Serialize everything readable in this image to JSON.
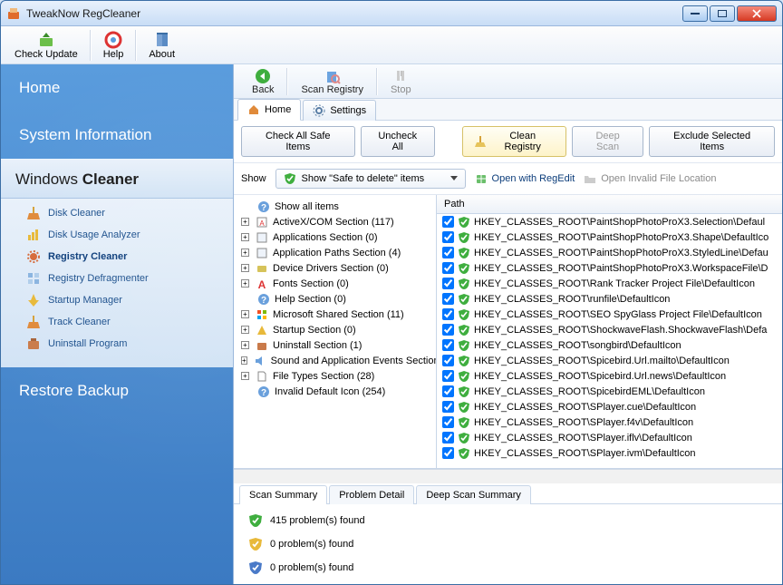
{
  "window": {
    "title": "TweakNow RegCleaner"
  },
  "toolbar_top": {
    "check_update": "Check Update",
    "help": "Help",
    "about": "About"
  },
  "sidebar": {
    "home": "Home",
    "system_info": "System Information",
    "cleaner_prefix": "Windows ",
    "cleaner_bold": "Cleaner",
    "restore": "Restore Backup",
    "sub": [
      {
        "label": "Disk Cleaner",
        "icon": "broom"
      },
      {
        "label": "Disk Usage Analyzer",
        "icon": "chart"
      },
      {
        "label": "Registry Cleaner",
        "icon": "gear",
        "active": true
      },
      {
        "label": "Registry Defragmenter",
        "icon": "defrag"
      },
      {
        "label": "Startup Manager",
        "icon": "startup"
      },
      {
        "label": "Track Cleaner",
        "icon": "broom"
      },
      {
        "label": "Uninstall Program",
        "icon": "uninstall"
      }
    ]
  },
  "main_toolbar": {
    "back": "Back",
    "scan": "Scan Registry",
    "stop": "Stop"
  },
  "tabs": {
    "home": "Home",
    "settings": "Settings"
  },
  "actions": {
    "check_all": "Check All Safe Items",
    "uncheck_all": "Uncheck All",
    "clean": "Clean Registry",
    "deep_scan": "Deep Scan",
    "exclude": "Exclude Selected Items"
  },
  "filter": {
    "show_label": "Show",
    "dropdown_text": "Show \"Safe to delete\" items",
    "open_regedit": "Open with RegEdit",
    "open_invalid": "Open Invalid File Location"
  },
  "tree": [
    {
      "label": "Show all items",
      "icon": "q"
    },
    {
      "label": "ActiveX/COM Section (117)",
      "icon": "ax",
      "exp": true
    },
    {
      "label": "Applications Section (0)",
      "icon": "app",
      "exp": true
    },
    {
      "label": "Application Paths Section (4)",
      "icon": "app",
      "exp": true
    },
    {
      "label": "Device Drivers Section (0)",
      "icon": "dev",
      "exp": true
    },
    {
      "label": "Fonts Section (0)",
      "icon": "font",
      "exp": true
    },
    {
      "label": "Help Section (0)",
      "icon": "q"
    },
    {
      "label": "Microsoft Shared Section (11)",
      "icon": "ms",
      "exp": true
    },
    {
      "label": "Startup Section (0)",
      "icon": "start",
      "exp": true
    },
    {
      "label": "Uninstall Section (1)",
      "icon": "uninst",
      "exp": true
    },
    {
      "label": "Sound and Application Events Section",
      "icon": "sound",
      "exp": true
    },
    {
      "label": "File Types Section (28)",
      "icon": "file",
      "exp": true
    },
    {
      "label": "Invalid Default Icon (254)",
      "icon": "q"
    }
  ],
  "list_header": "Path",
  "list": [
    "HKEY_CLASSES_ROOT\\PaintShopPhotoProX3.Selection\\Defaul",
    "HKEY_CLASSES_ROOT\\PaintShopPhotoProX3.Shape\\DefaultIco",
    "HKEY_CLASSES_ROOT\\PaintShopPhotoProX3.StyledLine\\Defau",
    "HKEY_CLASSES_ROOT\\PaintShopPhotoProX3.WorkspaceFile\\D",
    "HKEY_CLASSES_ROOT\\Rank Tracker Project File\\DefaultIcon",
    "HKEY_CLASSES_ROOT\\runfile\\DefaultIcon",
    "HKEY_CLASSES_ROOT\\SEO SpyGlass Project File\\DefaultIcon",
    "HKEY_CLASSES_ROOT\\ShockwaveFlash.ShockwaveFlash\\Defa",
    "HKEY_CLASSES_ROOT\\songbird\\DefaultIcon",
    "HKEY_CLASSES_ROOT\\Spicebird.Url.mailto\\DefaultIcon",
    "HKEY_CLASSES_ROOT\\Spicebird.Url.news\\DefaultIcon",
    "HKEY_CLASSES_ROOT\\SpicebirdEML\\DefaultIcon",
    "HKEY_CLASSES_ROOT\\SPlayer.cue\\DefaultIcon",
    "HKEY_CLASSES_ROOT\\SPlayer.f4v\\DefaultIcon",
    "HKEY_CLASSES_ROOT\\SPlayer.iflv\\DefaultIcon",
    "HKEY_CLASSES_ROOT\\SPlayer.ivm\\DefaultIcon"
  ],
  "bottom_tabs": {
    "summary": "Scan Summary",
    "detail": "Problem Detail",
    "deep": "Deep Scan Summary"
  },
  "summary": [
    {
      "shield": "green",
      "text": "415 problem(s) found"
    },
    {
      "shield": "yellow",
      "text": "0 problem(s) found"
    },
    {
      "shield": "blue",
      "text": "0 problem(s) found"
    }
  ]
}
